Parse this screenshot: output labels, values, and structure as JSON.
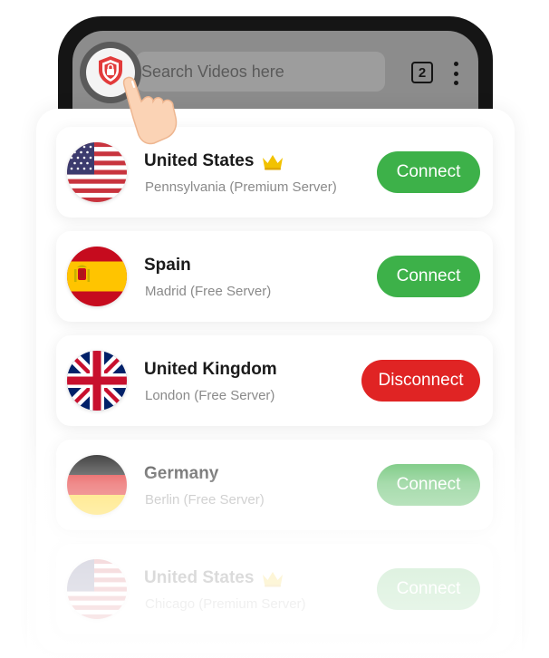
{
  "search": {
    "placeholder": "Search Videos here"
  },
  "toolbar": {
    "tab_count": "2",
    "vpn_icon": "shield-lock-icon",
    "menu_icon": "kebab-menu-icon"
  },
  "servers": [
    {
      "country": "United States",
      "location": "Pennsylvania (Premium Server)",
      "premium": true,
      "action": "Connect",
      "flag_icon": "us-flag-icon"
    },
    {
      "country": "Spain",
      "location": "Madrid (Free Server)",
      "premium": false,
      "action": "Connect",
      "flag_icon": "spain-flag-icon"
    },
    {
      "country": "United Kingdom",
      "location": "London (Free Server)",
      "premium": false,
      "action": "Disconnect",
      "flag_icon": "uk-flag-icon"
    },
    {
      "country": "Germany",
      "location": "Berlin (Free Server)",
      "premium": false,
      "action": "Connect",
      "flag_icon": "germany-flag-icon"
    },
    {
      "country": "United States",
      "location": "Chicago (Premium Server)",
      "premium": true,
      "action": "Connect",
      "flag_icon": "us-flag-icon"
    }
  ],
  "colors": {
    "connect": "#3db149",
    "disconnect": "#e02424",
    "crown": "#f2c200",
    "shield": "#e23b3b"
  }
}
